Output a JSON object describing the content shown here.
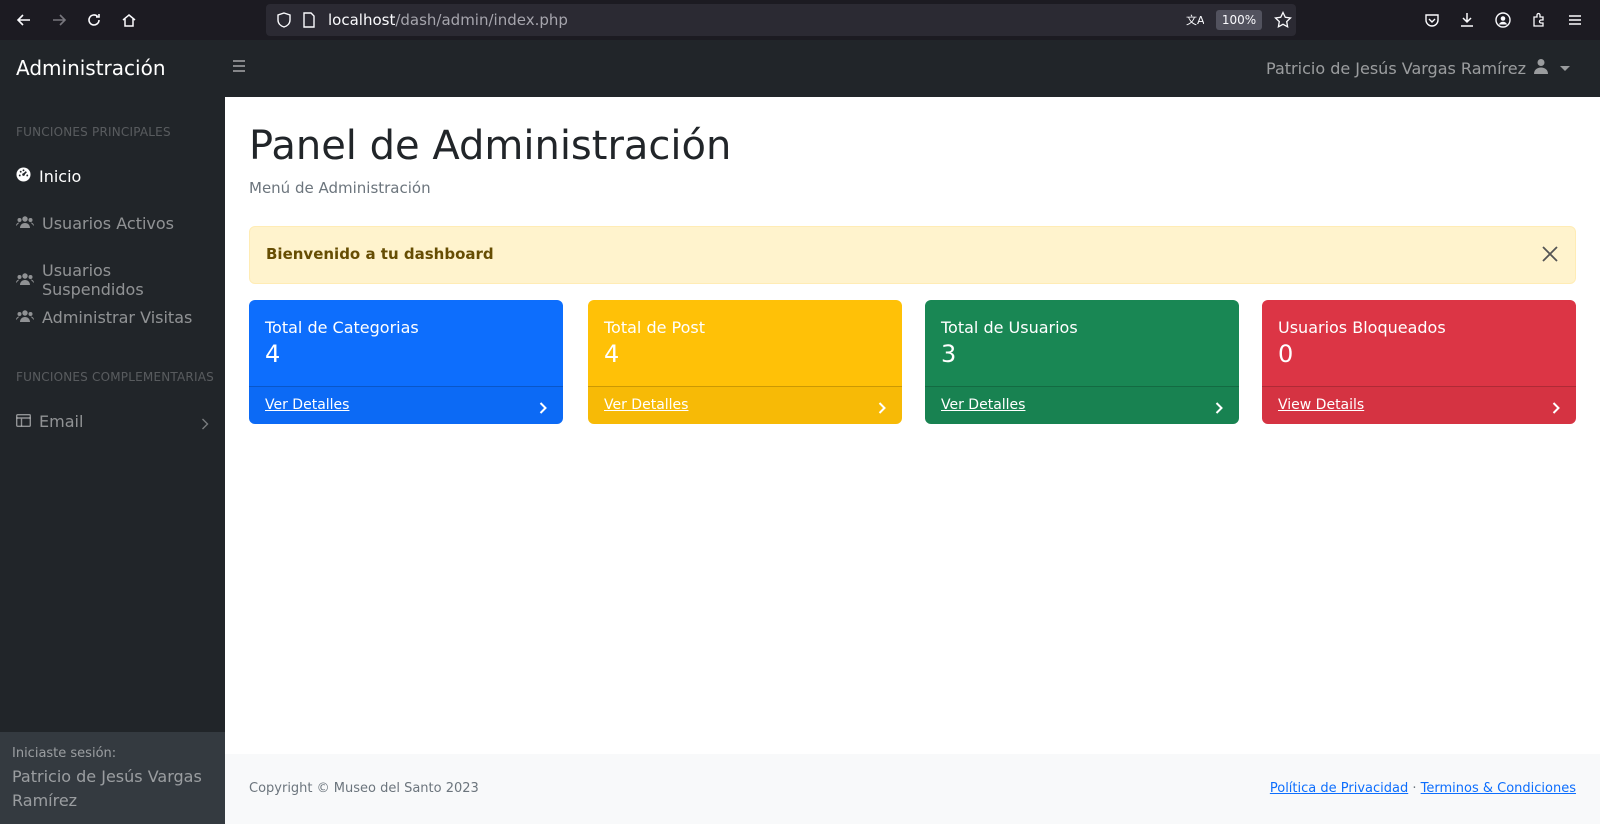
{
  "browser": {
    "url_host": "localhost",
    "url_path": "/dash/admin/index.php",
    "zoom": "100%"
  },
  "navbar": {
    "brand": "Administración",
    "user_name": "Patricio de Jesús Vargas Ramírez"
  },
  "sidebar": {
    "heading_main": "FUNCIONES PRINCIPALES",
    "items": [
      {
        "label": "Inicio",
        "icon": "dashboard-icon",
        "active": true
      },
      {
        "label": "Usuarios Activos",
        "icon": "users-icon"
      },
      {
        "label": "Usuarios Suspendidos",
        "icon": "users-icon"
      },
      {
        "label": "Administrar Visitas",
        "icon": "users-icon"
      }
    ],
    "heading_extra": "FUNCIONES COMPLEMENTARIAS",
    "extra_items": [
      {
        "label": "Email",
        "icon": "columns-icon"
      }
    ],
    "footer_small": "Iniciaste sesión:",
    "footer_name": "Patricio de Jesús Vargas Ramírez"
  },
  "main": {
    "title": "Panel de Administración",
    "subtitle": "Menú de Administración",
    "alert": "Bienvenido a tu dashboard",
    "cards": [
      {
        "title": "Total de Categorias",
        "value": "4",
        "link": "Ver Detalles",
        "color": "#0d6efd"
      },
      {
        "title": "Total de Post",
        "value": "4",
        "link": "Ver Detalles",
        "color": "#ffc107"
      },
      {
        "title": "Total de Usuarios",
        "value": "3",
        "link": "Ver Detalles",
        "color": "#198754"
      },
      {
        "title": "Usuarios Bloqueados",
        "value": "0",
        "link": "View Details",
        "color": "#dc3545"
      }
    ]
  },
  "footer": {
    "copyright": "Copyright © Museo del Santo 2023",
    "privacy": "Política de Privacidad",
    "separator": "·",
    "terms": "Terminos & Condiciones"
  }
}
